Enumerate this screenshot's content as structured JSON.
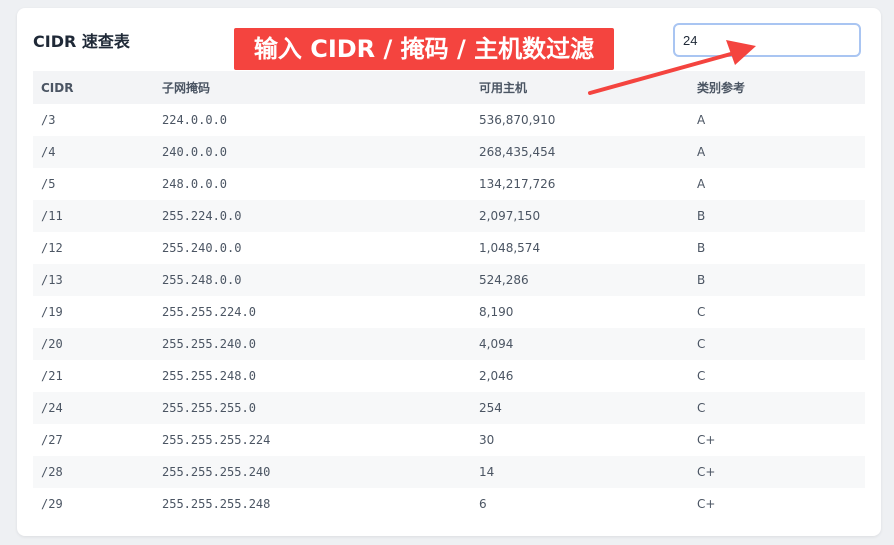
{
  "title": "CIDR 速查表",
  "search": {
    "value": "24"
  },
  "annotation": {
    "text": "输入 CIDR / 掩码 / 主机数过滤",
    "color": "#f4443f"
  },
  "table": {
    "headers": [
      "CIDR",
      "子网掩码",
      "可用主机",
      "类别参考"
    ],
    "rows": [
      [
        "/3",
        "224.0.0.0",
        "536,870,910",
        "A"
      ],
      [
        "/4",
        "240.0.0.0",
        "268,435,454",
        "A"
      ],
      [
        "/5",
        "248.0.0.0",
        "134,217,726",
        "A"
      ],
      [
        "/11",
        "255.224.0.0",
        "2,097,150",
        "B"
      ],
      [
        "/12",
        "255.240.0.0",
        "1,048,574",
        "B"
      ],
      [
        "/13",
        "255.248.0.0",
        "524,286",
        "B"
      ],
      [
        "/19",
        "255.255.224.0",
        "8,190",
        "C"
      ],
      [
        "/20",
        "255.255.240.0",
        "4,094",
        "C"
      ],
      [
        "/21",
        "255.255.248.0",
        "2,046",
        "C"
      ],
      [
        "/24",
        "255.255.255.0",
        "254",
        "C"
      ],
      [
        "/27",
        "255.255.255.224",
        "30",
        "C+"
      ],
      [
        "/28",
        "255.255.255.240",
        "14",
        "C+"
      ],
      [
        "/29",
        "255.255.255.248",
        "6",
        "C+"
      ]
    ]
  }
}
